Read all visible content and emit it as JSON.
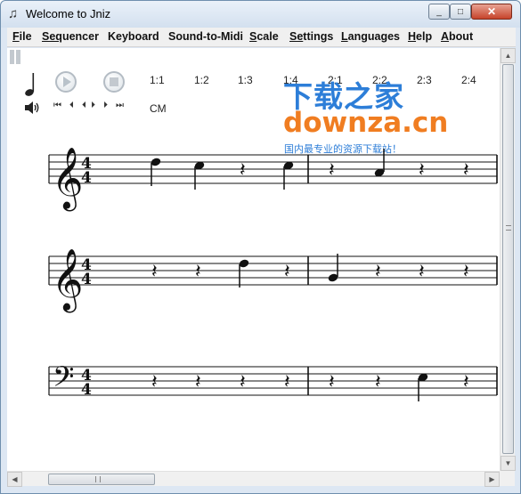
{
  "window": {
    "title": "Welcome to Jniz",
    "title_icon": "music-note-icon",
    "minimize": "_",
    "maximize": "□",
    "close": "✕"
  },
  "menu": [
    {
      "label": "File",
      "key": "F",
      "rest": "ile"
    },
    {
      "label": "Sequencer",
      "key": "Seq",
      "rest": "uencer"
    },
    {
      "label": "Keyboard",
      "key": "",
      "rest": "Keyboard"
    },
    {
      "label": "Sound-to-Midi",
      "key": "",
      "rest": "Sound-to-Midi"
    },
    {
      "label": "Scale",
      "key": "S",
      "rest": "cale"
    },
    {
      "label": "Settings",
      "key": "Se",
      "rest": "ttings"
    },
    {
      "label": "Languages",
      "key": "L",
      "rest": "anguages"
    },
    {
      "label": "Help",
      "key": "H",
      "rest": "elp"
    },
    {
      "label": "About",
      "key": "A",
      "rest": "bout"
    }
  ],
  "toolbar": {
    "ratios": [
      "1:1",
      "1:2",
      "1:3",
      "1:4",
      "2:1",
      "2:2",
      "2:3",
      "2:4"
    ],
    "transport": [
      "⏮",
      "⏴",
      "⏴",
      "⏵",
      "⏵",
      "⏭"
    ],
    "key": "CM"
  },
  "watermark": {
    "line1": "下载之家",
    "line2": "downza.cn",
    "line3": "国内最专业的资源下载站！"
  },
  "staves": [
    {
      "clef": "treble",
      "time_top": "4",
      "time_bottom": "4",
      "measures": [
        [
          {
            "type": "note",
            "pitch": "d"
          },
          {
            "type": "note",
            "pitch": "c"
          },
          {
            "type": "rest"
          },
          {
            "type": "note",
            "pitch": "c"
          }
        ],
        [
          {
            "type": "rest"
          },
          {
            "type": "note",
            "pitch": "a"
          },
          {
            "type": "rest"
          },
          {
            "type": "rest"
          }
        ]
      ]
    },
    {
      "clef": "treble",
      "time_top": "4",
      "time_bottom": "4",
      "measures": [
        [
          {
            "type": "rest"
          },
          {
            "type": "rest"
          },
          {
            "type": "note",
            "pitch": "d"
          },
          {
            "type": "rest"
          }
        ],
        [
          {
            "type": "note",
            "pitch": "g"
          },
          {
            "type": "rest"
          },
          {
            "type": "rest"
          },
          {
            "type": "rest"
          }
        ]
      ]
    },
    {
      "clef": "bass",
      "time_top": "4",
      "time_bottom": "4",
      "measures": [
        [
          {
            "type": "rest"
          },
          {
            "type": "rest"
          },
          {
            "type": "rest"
          },
          {
            "type": "rest"
          }
        ],
        [
          {
            "type": "rest"
          },
          {
            "type": "rest"
          },
          {
            "type": "note",
            "pitch": "e"
          },
          {
            "type": "rest"
          }
        ]
      ]
    }
  ]
}
